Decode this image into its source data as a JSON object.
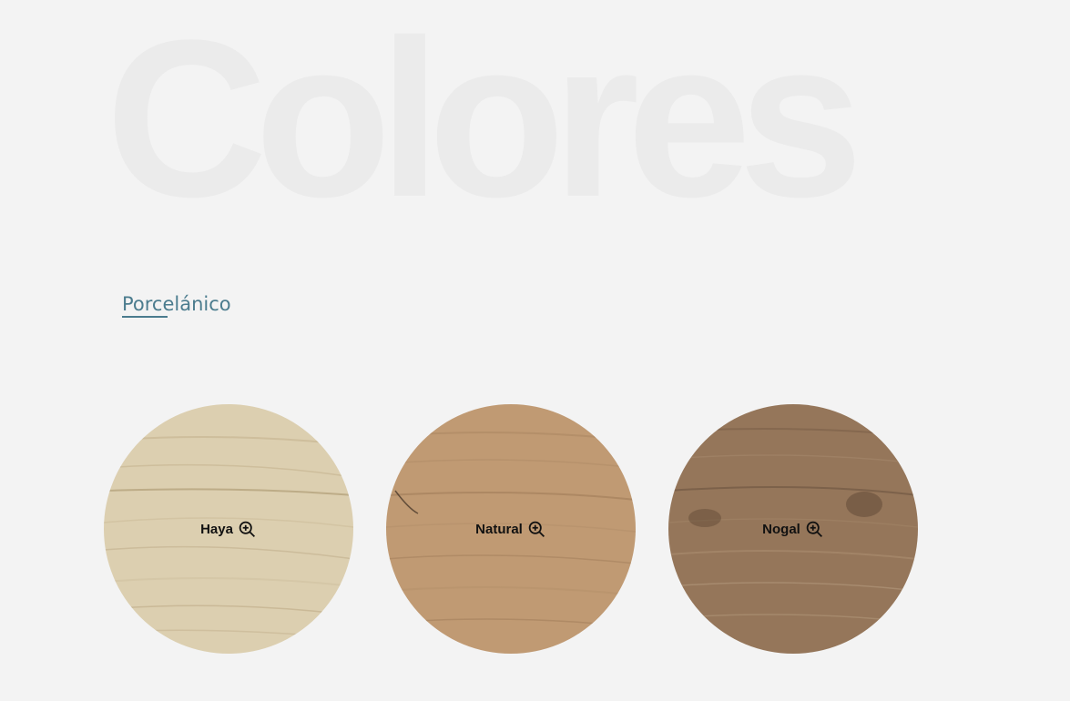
{
  "header": {
    "title": "Colores"
  },
  "category": {
    "label": "Porcelánico"
  },
  "swatches": [
    {
      "label": "Haya",
      "icon": "zoom-in-icon",
      "base_color": "#dccfb0",
      "grain_color": "#b8a680"
    },
    {
      "label": "Natural",
      "icon": "zoom-in-icon",
      "base_color": "#c09a73",
      "grain_color": "#9a7654"
    },
    {
      "label": "Nogal",
      "icon": "zoom-in-icon",
      "base_color": "#95765a",
      "grain_color": "#6d5440"
    }
  ],
  "colors": {
    "background": "#f3f3f3",
    "title": "#ebebeb",
    "link": "#4b7c8e"
  }
}
